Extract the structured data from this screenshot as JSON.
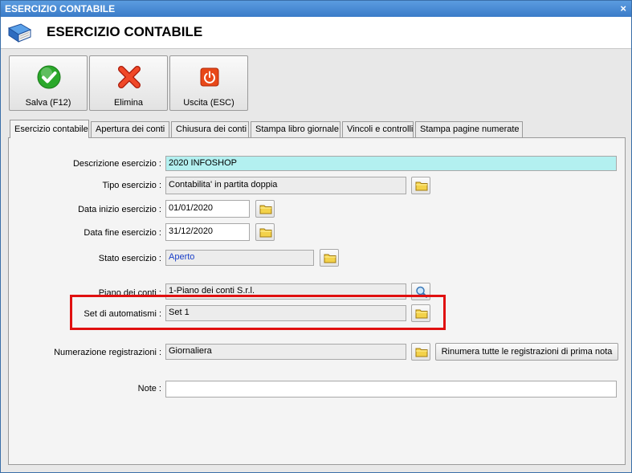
{
  "window": {
    "title": "ESERCIZIO CONTABILE",
    "close_glyph": "×",
    "header_title": "ESERCIZIO CONTABILE",
    "header_icon": "book-icon"
  },
  "toolbar": {
    "save": {
      "label": "Salva (F12)",
      "icon": "check-icon",
      "color": "#28a828"
    },
    "delete": {
      "label": "Elimina",
      "icon": "x-delete-icon",
      "color": "#e03018"
    },
    "exit": {
      "label": "Uscita (ESC)",
      "icon": "power-icon",
      "color": "#e04010"
    }
  },
  "tabs": [
    {
      "label": "Esercizio contabile",
      "active": true
    },
    {
      "label": "Apertura dei conti",
      "active": false
    },
    {
      "label": "Chiusura dei conti",
      "active": false
    },
    {
      "label": "Stampa libro giornale",
      "active": false
    },
    {
      "label": "Vincoli e controlli",
      "active": false
    },
    {
      "label": "Stampa pagine numerate",
      "active": false
    }
  ],
  "form": {
    "descrizione": {
      "label": "Descrizione esercizio :",
      "value": "2020 INFOSHOP"
    },
    "tipo": {
      "label": "Tipo esercizio :",
      "value": "Contabilita' in partita doppia"
    },
    "data_inizio": {
      "label": "Data inizio esercizio :",
      "value": "01/01/2020"
    },
    "data_fine": {
      "label": "Data fine esercizio :",
      "value": "31/12/2020"
    },
    "stato": {
      "label": "Stato esercizio :",
      "value": "Aperto"
    },
    "piano": {
      "label": "Piano dei conti :",
      "value": "1-Piano dei conti S.r.l."
    },
    "set_automatismi": {
      "label": "Set di automatismi :",
      "value": "Set 1"
    },
    "numerazione": {
      "label": "Numerazione registrazioni :",
      "value": "Giornaliera"
    },
    "rinumera_button": "Rinumera tutte le registrazioni di prima nota",
    "note": {
      "label": "Note :",
      "value": ""
    }
  },
  "colors": {
    "highlight": "#e01010",
    "cyan_field": "#b3f0f0",
    "status_text": "#1a3fc8"
  }
}
